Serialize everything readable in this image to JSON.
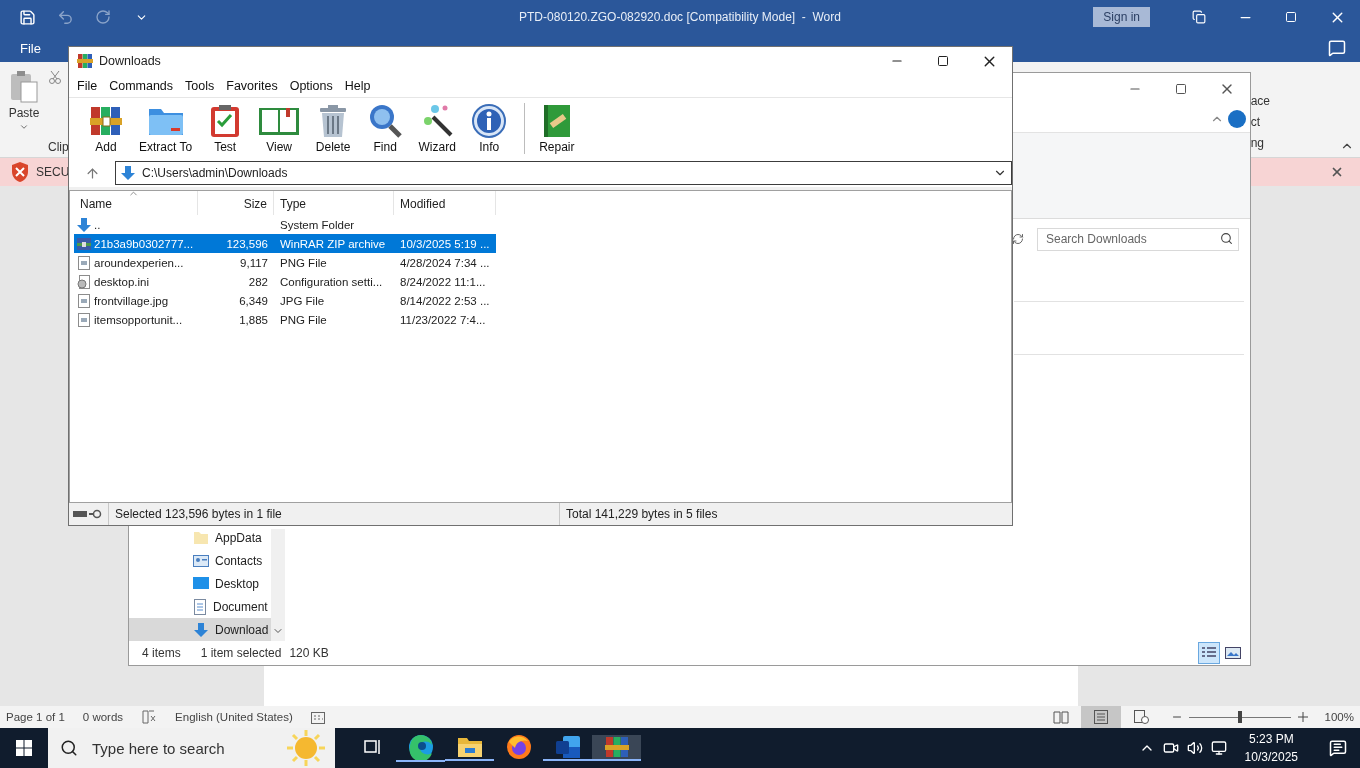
{
  "word": {
    "title": "PTD-080120.ZGO-082920.doc [Compatibility Mode]  -  Word",
    "sign_in": "Sign in",
    "tabs": [
      {
        "label": "File",
        "selected": false
      }
    ],
    "ribbon": {
      "paste": "Paste",
      "clipboard_group": "Clip",
      "right_fragments": [
        "ace",
        "ct",
        "ng"
      ]
    },
    "security_bar": {
      "label": "SECU"
    },
    "status_bar": {
      "page": "Page 1 of 1",
      "words": "0 words",
      "language": "English (United States)",
      "views": [
        {
          "kind": "read",
          "selected": false
        },
        {
          "kind": "print",
          "selected": true
        },
        {
          "kind": "web",
          "selected": false
        }
      ],
      "zoom": {
        "level": 0.5,
        "reading": "100%"
      }
    }
  },
  "explorer": {
    "search": {
      "placeholder": "Search Downloads"
    },
    "nav": [
      {
        "kind": "folder",
        "label": "AppData",
        "selected": false
      },
      {
        "kind": "contacts",
        "label": "Contacts",
        "selected": false
      },
      {
        "kind": "desktop",
        "label": "Desktop",
        "selected": false
      },
      {
        "kind": "documents",
        "label": "Document",
        "selected": false
      },
      {
        "kind": "downloads",
        "label": "Download",
        "selected": true
      }
    ],
    "status": {
      "items": "4 items",
      "selected": "1 item selected",
      "size": "120 KB"
    },
    "views": [
      {
        "kind": "details",
        "selected": true
      },
      {
        "kind": "large",
        "selected": false
      }
    ]
  },
  "winrar": {
    "title": "Downloads",
    "menu": [
      "File",
      "Commands",
      "Tools",
      "Favorites",
      "Options",
      "Help"
    ],
    "toolbar": [
      {
        "kind": "add",
        "label": "Add",
        "separator_before": false
      },
      {
        "kind": "extract",
        "label": "Extract To",
        "separator_before": false
      },
      {
        "kind": "test",
        "label": "Test",
        "separator_before": false
      },
      {
        "kind": "view",
        "label": "View",
        "separator_before": false
      },
      {
        "kind": "delete",
        "label": "Delete",
        "separator_before": false
      },
      {
        "kind": "find",
        "label": "Find",
        "separator_before": false
      },
      {
        "kind": "wizard",
        "label": "Wizard",
        "separator_before": false
      },
      {
        "kind": "info",
        "label": "Info",
        "separator_before": false
      },
      {
        "kind": "repair",
        "label": "Repair",
        "separator_before": true
      }
    ],
    "path": "C:\\Users\\admin\\Downloads",
    "columns": [
      {
        "label": "Name",
        "sorted": true
      },
      {
        "label": "Size",
        "sorted": false
      },
      {
        "label": "Type",
        "sorted": false
      },
      {
        "label": "Modified",
        "sorted": false
      }
    ],
    "rows": [
      {
        "kind": "parent",
        "name": "..",
        "type": "System Folder",
        "selected": false
      },
      {
        "kind": "archive",
        "name": "21b3a9b0302777...",
        "size": "123,596",
        "type": "WinRAR ZIP archive",
        "modified": "10/3/2025 5:19 ...",
        "selected": true
      },
      {
        "kind": "file",
        "name": "aroundexperien...",
        "size": "9,117",
        "type": "PNG File",
        "modified": "4/28/2024 7:34 ...",
        "selected": false
      },
      {
        "kind": "config",
        "name": "desktop.ini",
        "size": "282",
        "type": "Configuration setti...",
        "modified": "8/24/2022 11:1...",
        "selected": false
      },
      {
        "kind": "file",
        "name": "frontvillage.jpg",
        "size": "6,349",
        "type": "JPG File",
        "modified": "8/14/2022 2:53 ...",
        "selected": false
      },
      {
        "kind": "file",
        "name": "itemsopportunit...",
        "size": "1,885",
        "type": "PNG File",
        "modified": "11/23/2022 7:4...",
        "selected": false
      }
    ],
    "status_left": "Selected 123,596 bytes in 1 file",
    "status_right": "Total 141,229 bytes in 5 files"
  },
  "taskbar": {
    "search_placeholder": "Type here to search",
    "apps": [
      {
        "kind": "taskview",
        "running": false,
        "selected": false
      },
      {
        "kind": "edge",
        "running": true,
        "selected": false
      },
      {
        "kind": "files",
        "running": true,
        "selected": false
      },
      {
        "kind": "firefox",
        "running": false,
        "selected": false
      },
      {
        "kind": "word",
        "running": true,
        "selected": false
      },
      {
        "kind": "winrar",
        "running": true,
        "selected": true
      }
    ],
    "time": "5:23 PM",
    "date": "10/3/2025"
  }
}
